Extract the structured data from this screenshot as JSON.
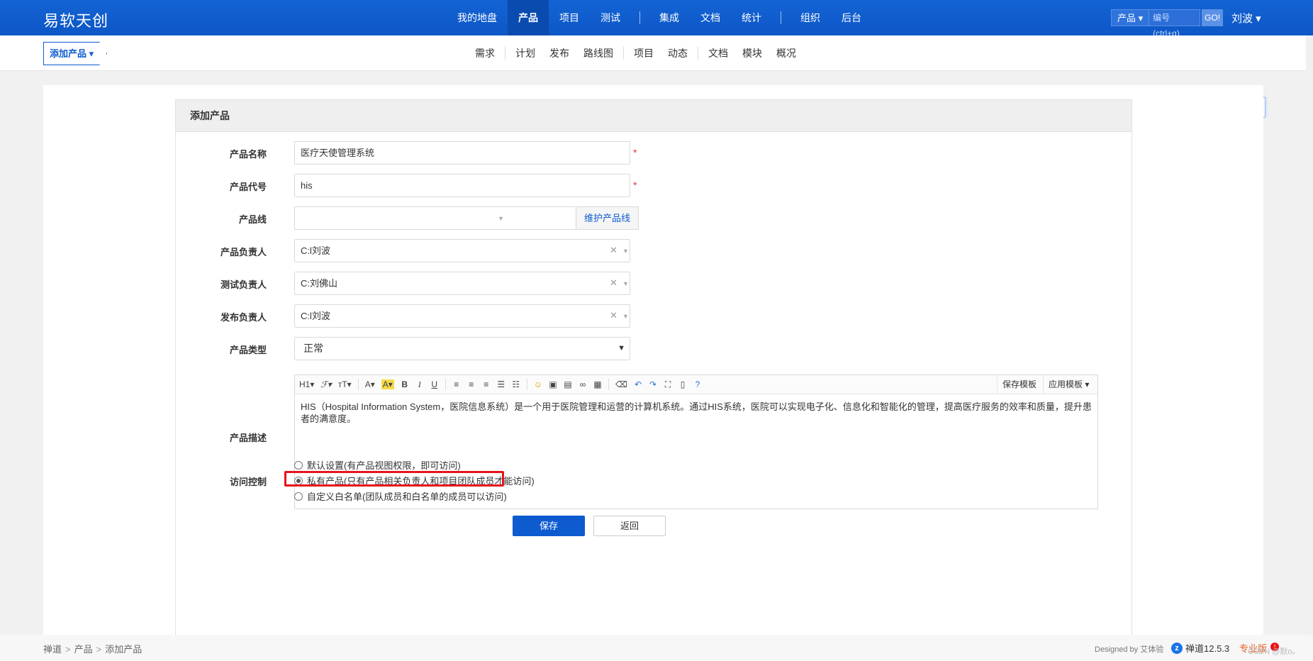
{
  "header": {
    "brand": "易软天创",
    "nav": [
      "我的地盘",
      "产品",
      "项目",
      "测试",
      "集成",
      "文档",
      "统计",
      "组织",
      "后台"
    ],
    "active_nav": "产品",
    "search_type": "产品 ▾",
    "search_placeholder": "编号(ctrl+g)",
    "search_go": "GO!",
    "user": "刘波 ▾"
  },
  "subheader": {
    "crumb_button": "添加产品 ▾",
    "subnav": [
      "需求",
      "计划",
      "发布",
      "路线图",
      "项目",
      "动态",
      "文档",
      "模块",
      "概况"
    ]
  },
  "form": {
    "panel_title": "添加产品",
    "labels": {
      "name": "产品名称",
      "code": "产品代号",
      "line": "产品线",
      "owner": "产品负责人",
      "qa": "测试负责人",
      "release": "发布负责人",
      "type": "产品类型",
      "desc": "产品描述",
      "acl": "访问控制"
    },
    "values": {
      "name": "医疗天使管理系统",
      "code": "his",
      "line": "",
      "owner": "C:l刘波",
      "qa": "C:刘佛山",
      "release": "C:l刘波",
      "type": "正常"
    },
    "required_mark": "*",
    "line_addon": "维护产品线",
    "editor": {
      "toolbar": [
        "H1▾",
        "ℱ▾",
        "ᴛT▾",
        "A▾",
        "A▾",
        "B",
        "I",
        "U"
      ],
      "save_template": "保存模板",
      "apply_template": "应用模板 ▾",
      "content": "HIS（Hospital Information System，医院信息系统）是一个用于医院管理和运营的计算机系统。通过HIS系统，医院可以实现电子化、信息化和智能化的管理，提高医疗服务的效率和质量，提升患者的满意度。"
    },
    "acl_options": [
      "默认设置(有产品视图权限，即可访问)",
      "私有产品(只有产品相关负责人和项目团队成员才能访问)",
      "自定义白名单(团队成员和白名单的成员可以访问)"
    ],
    "acl_selected": 1,
    "save_label": "保存",
    "back_label": "返回"
  },
  "footer": {
    "crumbs": [
      "禅道",
      "产品",
      "添加产品"
    ],
    "designed_by": "Designed by 艾体验",
    "version": "禅道12.5.3",
    "edition": "专业版",
    "watermark": "CSDN @默o。"
  },
  "colors": {
    "primary": "#0e5bd0",
    "header": "#1463d4",
    "highlight": "#e8141b"
  }
}
